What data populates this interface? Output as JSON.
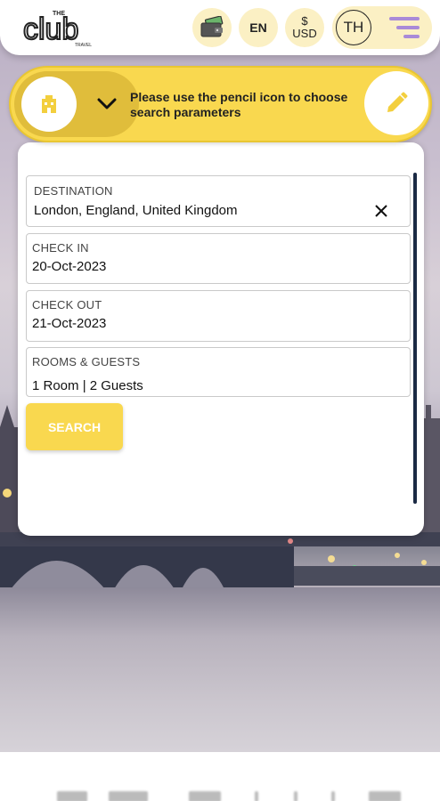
{
  "header": {
    "logo": {
      "top": "THE",
      "main": "club",
      "sub": "TRAVEL"
    },
    "language": "EN",
    "currency": {
      "symbol": "$",
      "code": "USD"
    },
    "user_initials": "TH"
  },
  "banner": {
    "message": "Please use the pencil icon to choose search parameters"
  },
  "form": {
    "destination": {
      "label": "DESTINATION",
      "value": "London, England, United Kingdom"
    },
    "check_in": {
      "label": "CHECK IN",
      "value": "20-Oct-2023"
    },
    "check_out": {
      "label": "CHECK OUT",
      "value": "21-Oct-2023"
    },
    "rooms_guests": {
      "label": "ROOMS & GUESTS",
      "value": "1 Room | 2  Guests"
    },
    "search_label": "SEARCH"
  },
  "colors": {
    "accent_yellow": "#f9d84f",
    "pill_cream": "#fbf0c4",
    "menu_purple": "#a98ad8"
  },
  "icons": {
    "wallet": "wallet-icon",
    "hotel": "hotel-icon",
    "chevron": "chevron-down-icon",
    "pencil": "pencil-icon",
    "clear": "close-icon",
    "menu": "menu-icon"
  }
}
